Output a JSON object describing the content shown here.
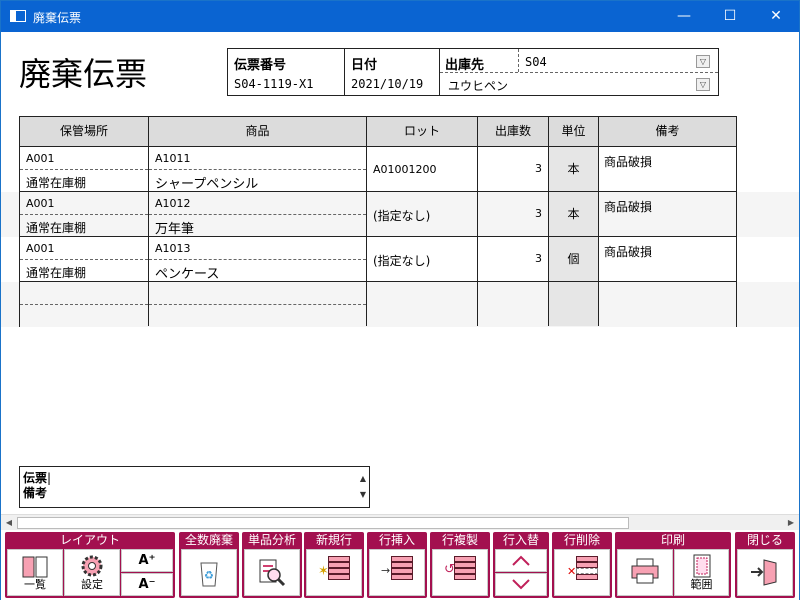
{
  "window": {
    "title": "廃棄伝票",
    "min_glyph": "—",
    "max_glyph": "☐",
    "close_glyph": "✕"
  },
  "doc_title": "廃棄伝票",
  "header": {
    "slip_no_label": "伝票番号",
    "slip_no": "S04-1119-X1",
    "date_label": "日付",
    "date": "2021/10/19",
    "dest_label": "出庫先",
    "dest_code": "S04",
    "dest_name": "ユウヒペン"
  },
  "grid": {
    "columns": [
      "保管場所",
      "商品",
      "ロット",
      "出庫数",
      "単位",
      "備考"
    ],
    "rows": [
      {
        "location_code": "A001",
        "location_name": "通常在庫棚",
        "item_code": "A1011",
        "item_name": "シャープペンシル",
        "lot": "A01001200",
        "qty": "3",
        "unit": "本",
        "note": "商品破損"
      },
      {
        "location_code": "A001",
        "location_name": "通常在庫棚",
        "item_code": "A1012",
        "item_name": "万年筆",
        "lot": "(指定なし)",
        "qty": "3",
        "unit": "本",
        "note": "商品破損"
      },
      {
        "location_code": "A001",
        "location_name": "通常在庫棚",
        "item_code": "A1013",
        "item_name": "ペンケース",
        "lot": "(指定なし)",
        "qty": "3",
        "unit": "個",
        "note": "商品破損"
      }
    ]
  },
  "memo": {
    "label_line1": "伝票",
    "label_line2": "備考",
    "value": ""
  },
  "toolbar": {
    "layout": {
      "label": "レイアウト",
      "list": "一覧",
      "settings": "設定",
      "font_up": "A⁺",
      "font_down": "A⁻"
    },
    "discard_all": {
      "label": "全数廃棄"
    },
    "item_analysis": {
      "label": "単品分析"
    },
    "new_row": {
      "label": "新規行"
    },
    "insert_row": {
      "label": "行挿入"
    },
    "copy_row": {
      "label": "行複製"
    },
    "swap_row": {
      "label": "行入替"
    },
    "delete_row": {
      "label": "行削除"
    },
    "print": {
      "label": "印刷",
      "range": "範囲"
    },
    "close": {
      "label": "閉じる"
    }
  },
  "colors": {
    "titlebar": "#0a64d2",
    "toolbar_group": "#a3104f",
    "row_icon": "#f7a1b3"
  }
}
